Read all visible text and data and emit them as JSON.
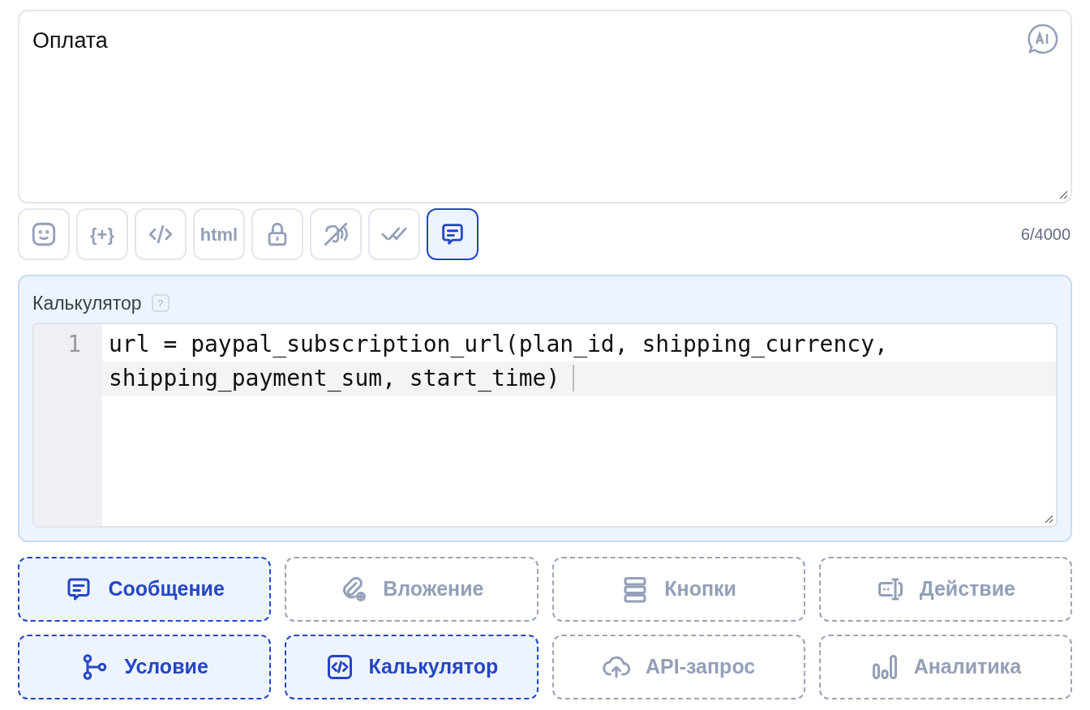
{
  "message": {
    "value": "Оплата"
  },
  "toolbar": [
    {
      "kind": "emoji",
      "selected": false
    },
    {
      "kind": "text",
      "label": "{+}",
      "selected": false
    },
    {
      "kind": "code",
      "selected": false
    },
    {
      "kind": "text",
      "label": "html",
      "selected": false
    },
    {
      "kind": "lock",
      "selected": false
    },
    {
      "kind": "mute",
      "selected": false
    },
    {
      "kind": "checks",
      "selected": false
    },
    {
      "kind": "message",
      "selected": true
    }
  ],
  "counter": "6/4000",
  "calculator": {
    "label": "Калькулятор",
    "help": "?",
    "line_numbers": [
      "1"
    ],
    "code": "url = paypal_subscription_url(plan_id, shipping_currency, shipping_payment_sum, start_time)"
  },
  "blocks": [
    {
      "kind": "message",
      "label": "Сообщение",
      "selected": true
    },
    {
      "kind": "attachment",
      "label": "Вложение",
      "selected": false
    },
    {
      "kind": "buttons",
      "label": "Кнопки",
      "selected": false
    },
    {
      "kind": "action",
      "label": "Действие",
      "selected": false
    },
    {
      "kind": "condition",
      "label": "Условие",
      "selected": true
    },
    {
      "kind": "calculator",
      "label": "Калькулятор",
      "selected": true
    },
    {
      "kind": "api",
      "label": "API-запрос",
      "selected": false
    },
    {
      "kind": "analytics",
      "label": "Аналитика",
      "selected": false
    }
  ]
}
